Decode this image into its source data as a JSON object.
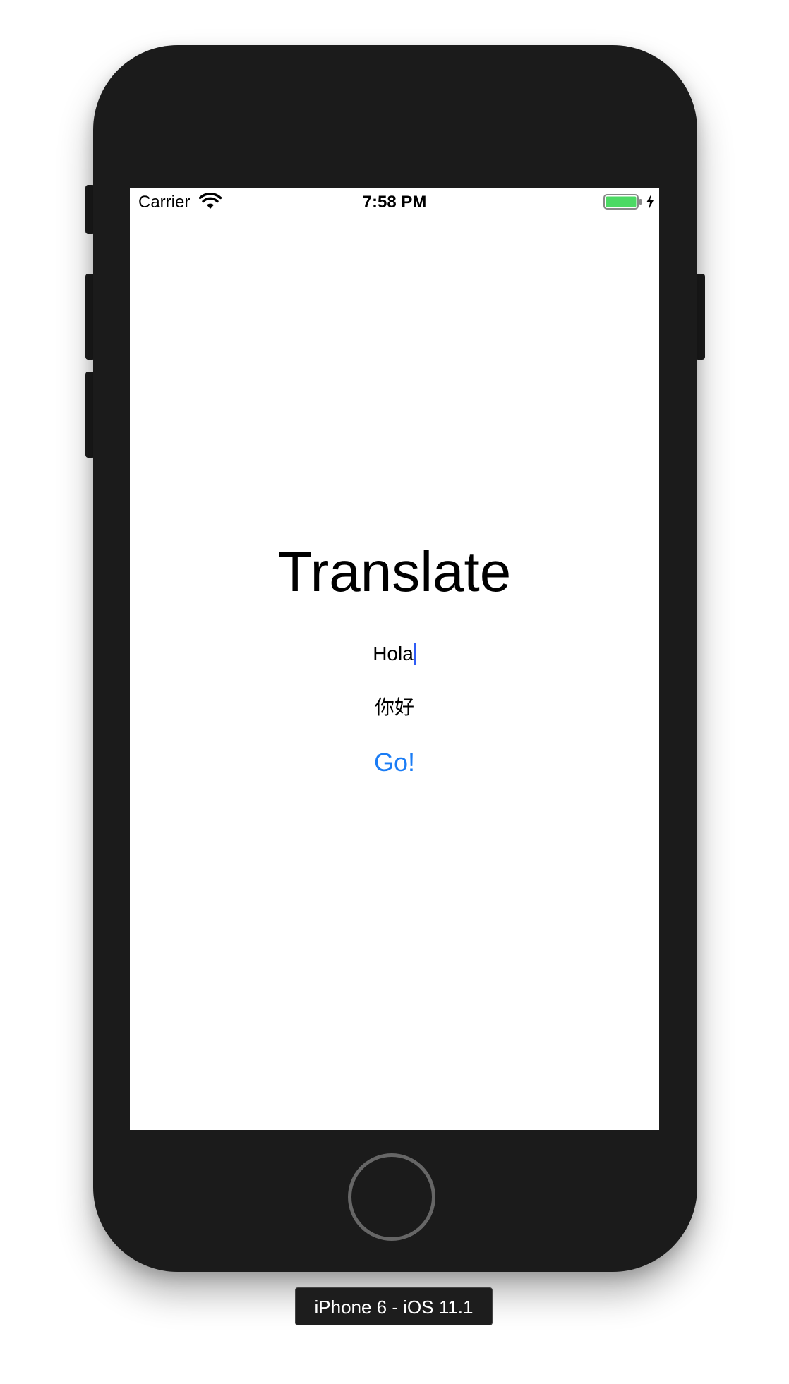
{
  "status_bar": {
    "carrier": "Carrier",
    "time": "7:58 PM",
    "wifi_icon": "wifi-icon",
    "battery_icon": "battery-icon",
    "charging_icon": "charging-bolt-icon",
    "battery_color": "#4cd964"
  },
  "main": {
    "title": "Translate",
    "input_value": "Hola",
    "output_text": "你好",
    "go_label": "Go!"
  },
  "device": {
    "label": "iPhone 6 - iOS 11.1"
  },
  "colors": {
    "accent": "#1a7cf5",
    "caret": "#2f5cf5",
    "device_body": "#1b1b1b"
  }
}
